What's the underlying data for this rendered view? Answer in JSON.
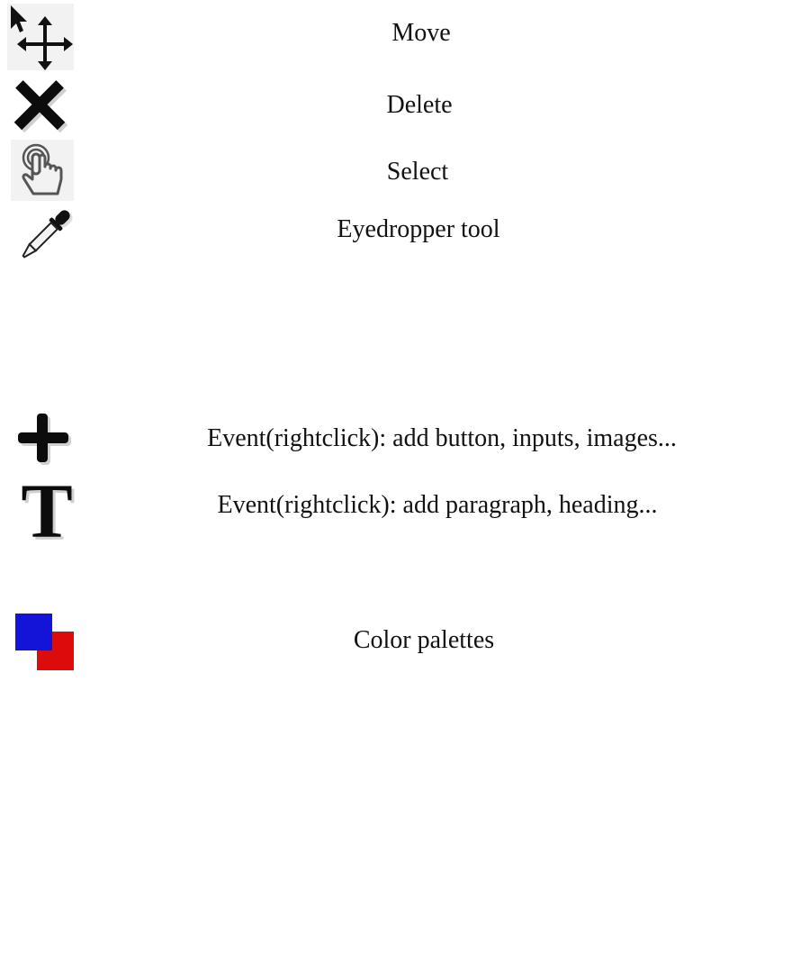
{
  "tools": {
    "move": {
      "label": "Move",
      "icon": "move-cursor-icon"
    },
    "delete": {
      "label": "Delete",
      "icon": "delete-x-icon"
    },
    "select": {
      "label": "Select",
      "icon": "pointing-hand-icon"
    },
    "eyedropper": {
      "label": "Eyedropper tool",
      "icon": "eyedropper-icon"
    },
    "add_element": {
      "label": "Event(rightclick): add button, inputs, images...",
      "icon": "plus-icon"
    },
    "add_text": {
      "label": "Event(rightclick): add paragraph, heading...",
      "icon": "text-t-icon"
    },
    "color_palettes": {
      "label": "Color palettes",
      "icon": "color-palettes-icon",
      "colors": {
        "primary": "#1414d8",
        "secondary": "#dc0c0c"
      }
    }
  }
}
